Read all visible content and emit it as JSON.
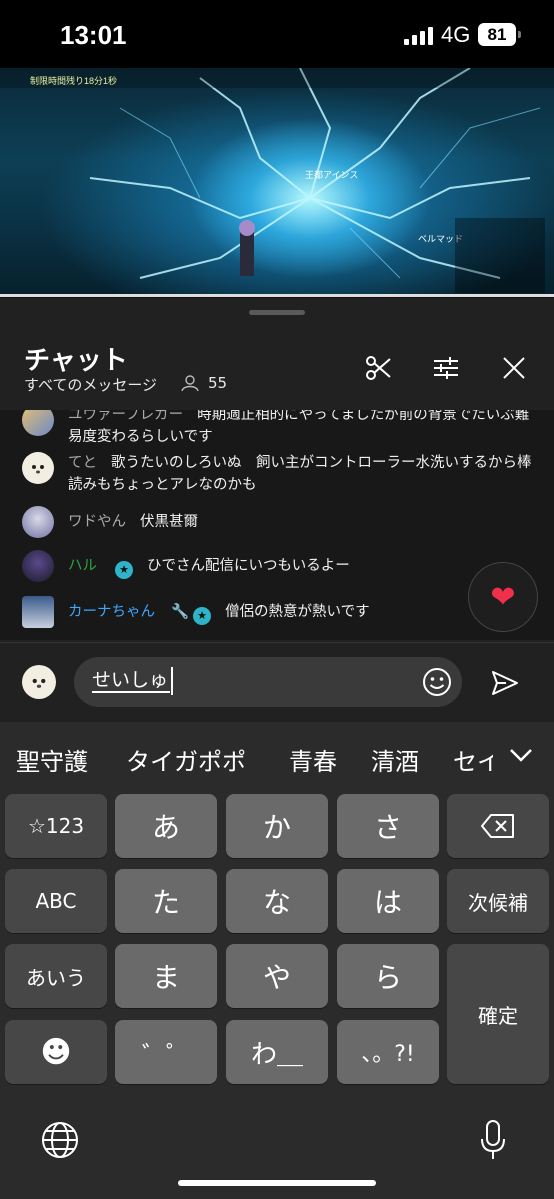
{
  "status": {
    "time": "13:01",
    "network": "4G",
    "battery": "81"
  },
  "video": {
    "hud_top_left": "制限時間残り18分1秒",
    "hud_mid": "王都アインス",
    "hud_bottom_right": "ベルマッド"
  },
  "chat": {
    "title": "チャット",
    "filter": "すべてのメッセージ",
    "viewers": "55",
    "messages": [
      {
        "author": "ユウァーフレガー",
        "text": "時期適正相的にやってましたが前の背景でたいぶ難易度変わるらしいです"
      },
      {
        "author": "てと",
        "text": "歌うたいのしろいぬ　飼い主がコントローラー水洗いするから棒読みもちょっとアレなのかも"
      },
      {
        "author": "ワドやん",
        "text": "伏黒甚爾"
      },
      {
        "author": "ハル",
        "badge": "★",
        "text": "ひでさん配信にいつもいるよー"
      },
      {
        "author": "カーナちゃん",
        "badge": "★",
        "text": "僧侶の熱意が熱いです"
      }
    ],
    "heart": "❤",
    "input_value": "せいしゅ",
    "emoji_icon": "smiley-icon"
  },
  "keyboard": {
    "candidates": [
      "聖守護",
      "タイガポポ",
      "青春",
      "清酒",
      "セイ"
    ],
    "keys": {
      "num": "☆123",
      "abc": "ABC",
      "kana": "あいう",
      "emoji": "☻",
      "a": "あ",
      "ka": "か",
      "sa": "さ",
      "ta": "た",
      "na": "な",
      "ha": "は",
      "ma": "ま",
      "ya": "や",
      "ra": "ら",
      "dakuten": "゛゜",
      "wa": "わ＿",
      "punct": "、。?!",
      "next": "次候補",
      "confirm": "確定"
    }
  }
}
